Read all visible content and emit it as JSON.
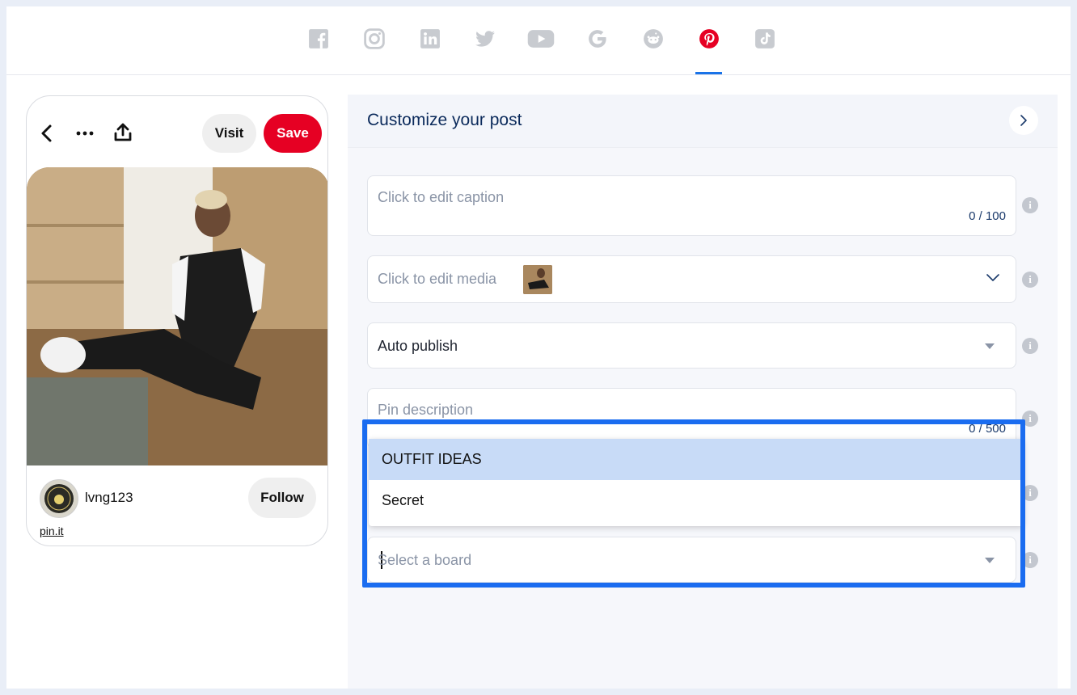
{
  "social_tabs": [
    {
      "name": "facebook-icon",
      "color": "#c8cbd0"
    },
    {
      "name": "instagram-icon",
      "color": "#c8cbd0"
    },
    {
      "name": "linkedin-icon",
      "color": "#c8cbd0"
    },
    {
      "name": "twitter-icon",
      "color": "#c8cbd0"
    },
    {
      "name": "youtube-icon",
      "color": "#c8cbd0"
    },
    {
      "name": "google-icon",
      "color": "#c8cbd0"
    },
    {
      "name": "reddit-icon",
      "color": "#c8cbd0"
    },
    {
      "name": "pinterest-icon",
      "color": "#e60023",
      "active": true
    },
    {
      "name": "tiktok-icon",
      "color": "#c8cbd0"
    }
  ],
  "preview": {
    "visit_label": "Visit",
    "save_label": "Save",
    "username": "lvng123",
    "follow_label": "Follow",
    "link": "pin.it",
    "save_color": "#e60023"
  },
  "panel": {
    "title": "Customize your post",
    "caption": {
      "placeholder": "Click to edit caption",
      "counter": "0 / 100"
    },
    "media": {
      "placeholder": "Click to edit media"
    },
    "publish": {
      "value": "Auto publish"
    },
    "description": {
      "placeholder": "Pin description",
      "counter": "0 / 500"
    },
    "board": {
      "placeholder": "Select a board"
    }
  },
  "dropdown": {
    "options": [
      {
        "label": "OUTFIT IDEAS",
        "active": true
      },
      {
        "label": "Secret",
        "active": false
      }
    ]
  },
  "accent": "#1a6cf0"
}
